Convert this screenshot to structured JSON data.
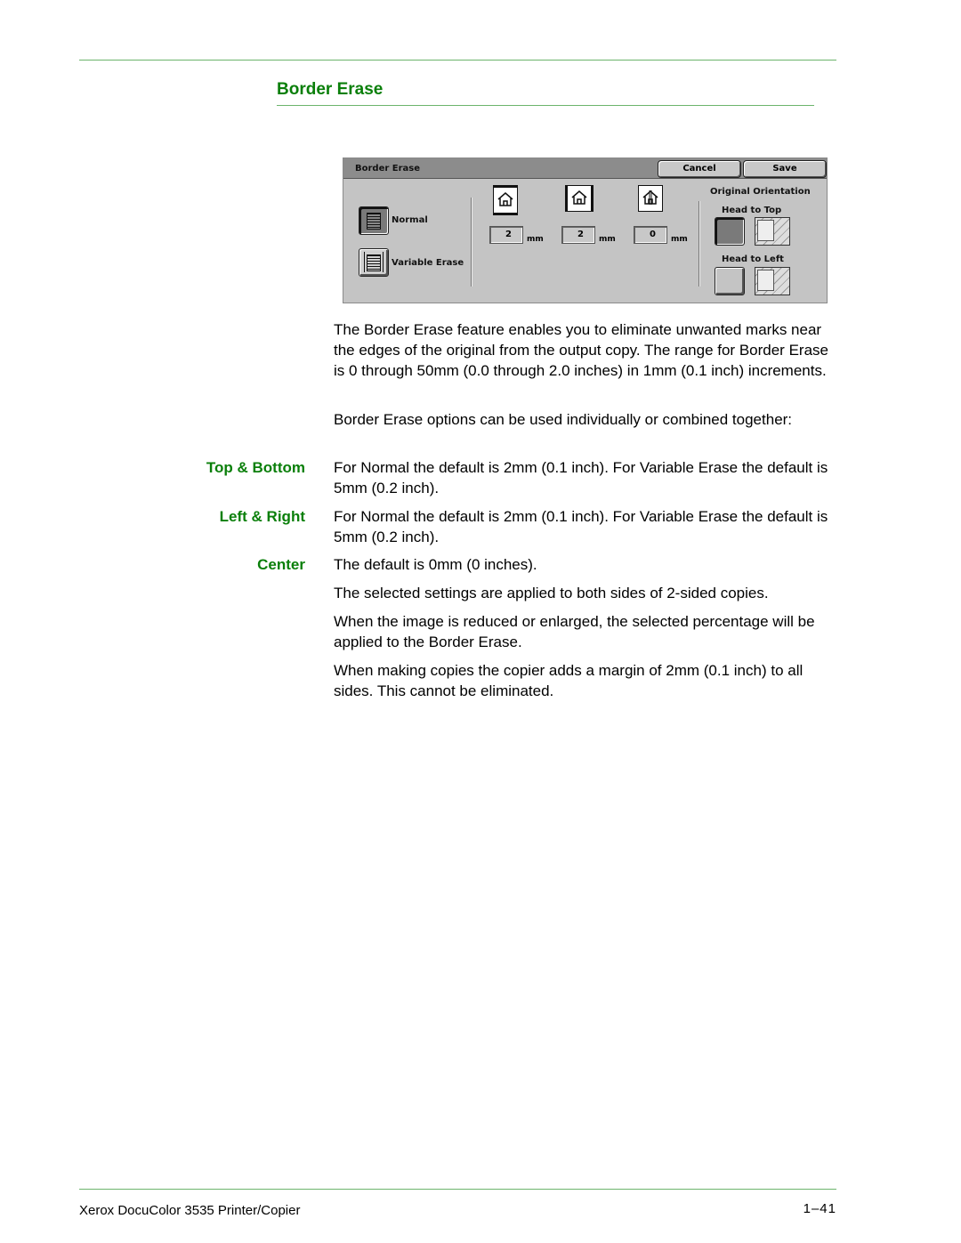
{
  "section": {
    "title": "Border Erase"
  },
  "panel": {
    "title": "Border Erase",
    "cancel_label": "Cancel",
    "save_label": "Save",
    "modes": [
      {
        "label": "Normal",
        "selected": true
      },
      {
        "label": "Variable Erase",
        "selected": false
      }
    ],
    "fields": [
      {
        "name": "top-bottom",
        "value": "2",
        "unit": "mm"
      },
      {
        "name": "left-right",
        "value": "2",
        "unit": "mm"
      },
      {
        "name": "center",
        "value": "0",
        "unit": "mm"
      }
    ],
    "orientation": {
      "title": "Original Orientation",
      "options": [
        {
          "label": "Head to Top",
          "selected": true
        },
        {
          "label": "Head to Left",
          "selected": false
        }
      ]
    }
  },
  "body": {
    "intro": "The Border Erase feature enables you to eliminate unwanted marks near the edges of the original from the output copy.  The range for Border Erase is 0 through 50mm (0.0 through 2.0 inches) in 1mm (0.1 inch) increments.",
    "options_intro": "Border Erase options can be used individually or combined together:",
    "terms": [
      {
        "term": "Top & Bottom",
        "desc": "For Normal the default is 2mm (0.1 inch). For Variable Erase the default is 5mm (0.2 inch)."
      },
      {
        "term": "Left & Right",
        "desc": "For Normal the default is 2mm (0.1 inch). For Variable Erase the default is 5mm (0.2 inch)."
      },
      {
        "term": "Center",
        "desc": "The default is 0mm (0 inches)."
      }
    ],
    "note1": "The selected settings are applied to both sides of 2-sided copies.",
    "note2": "When the image is reduced or enlarged, the selected percentage will be applied to the Border Erase.",
    "note3": "When making copies the copier adds a margin of 2mm (0.1 inch) to all sides.  This cannot be eliminated."
  },
  "footer": {
    "product": "Xerox DocuColor 3535 Printer/Copier",
    "page": "1–41"
  }
}
